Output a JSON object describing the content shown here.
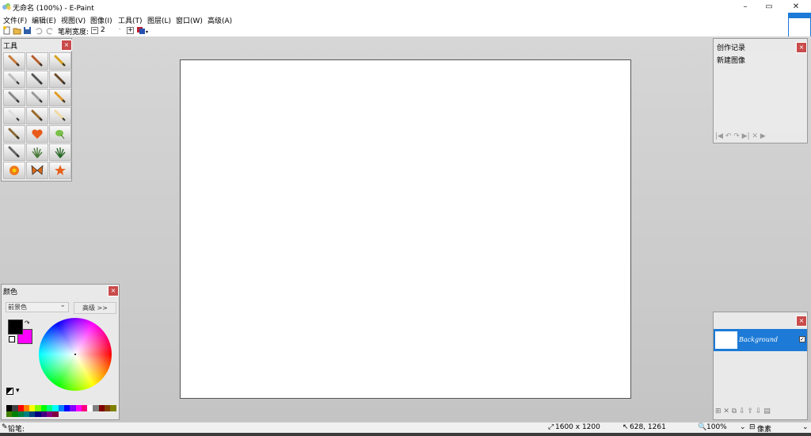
{
  "window": {
    "title": "无命名 (100%) - E-Paint",
    "minimize": "–",
    "maximize": "▭",
    "close": "✕"
  },
  "menu": [
    "文件(F)",
    "编辑(E)",
    "视图(V)",
    "图像(I)",
    "工具(T)",
    "图层(L)",
    "窗口(W)",
    "高级(A)"
  ],
  "toolbar": {
    "brush_label": "笔刷宽度:",
    "brush_minus": "−",
    "brush_value": "2",
    "brush_dropdown": "·",
    "brush_plus": "+"
  },
  "tools_panel": {
    "title": "工具",
    "close": "×",
    "tools": [
      "pencil-icon",
      "brush-icon",
      "marker-icon",
      "eraser-icon",
      "airbrush-icon",
      "calligraphy-icon",
      "smudge-icon",
      "knife-icon",
      "roller-icon",
      "tube-icon",
      "pen-icon",
      "chalk-icon",
      "crayon-icon",
      "heart-stamp-icon",
      "leaf-stamp-icon",
      "feather-icon",
      "grass-icon",
      "grass-tuft-icon",
      "flower-icon",
      "butterfly-icon",
      "star-icon"
    ]
  },
  "colors_panel": {
    "title": "颜色",
    "close": "×",
    "dropdown_value": "前景色",
    "advanced_button": "高级 >>",
    "primary_color": "#000000",
    "secondary_color": "#ff00ff",
    "swap": "↷",
    "palette_menu": "▾",
    "palette": [
      "#000000",
      "#404040",
      "#ff0000",
      "#ff8000",
      "#ffff00",
      "#80ff00",
      "#00ff00",
      "#00ff80",
      "#00ffff",
      "#0080ff",
      "#0000ff",
      "#8000ff",
      "#ff00ff",
      "#ff0080",
      "#ffffff",
      "#808080",
      "#800000",
      "#804000",
      "#808000",
      "#408000",
      "#008000",
      "#008040",
      "#008080",
      "#004080",
      "#000080",
      "#400080",
      "#800080",
      "#800040"
    ]
  },
  "history_panel": {
    "title": "创作记录",
    "close": "×",
    "item": "新建图像",
    "controls": "|◀ ↶ ↷ ▶| ✕ ▶"
  },
  "layers_panel": {
    "close": "×",
    "layer_name": "Background",
    "visible_mark": "✓",
    "controls": "⊞ ✕ ⧉ ⇩ ⇧ ⇩ ▤"
  },
  "status": {
    "tool": "铅笔:",
    "size": "1600 x 1200",
    "cursor": "628, 1261",
    "zoom": "100%",
    "zoom_dd": "⌄",
    "unit": "像素",
    "unit_dd": "⌄"
  }
}
